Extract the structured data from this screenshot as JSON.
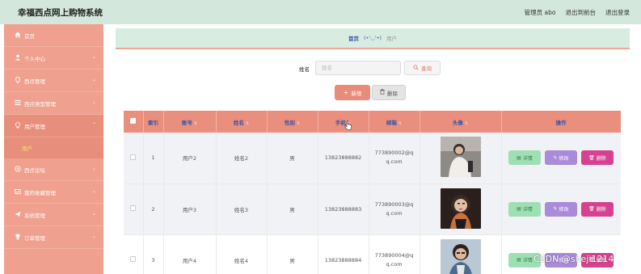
{
  "header": {
    "title": "幸福西点网上购物系统",
    "admin": "管理员 abo",
    "back_to_front": "退出到前台",
    "logout": "退出登录"
  },
  "sidebar": {
    "items": [
      {
        "label": "首页",
        "icon": "home-icon",
        "expandable": false
      },
      {
        "label": "个人中心",
        "icon": "person-icon",
        "expandable": true
      },
      {
        "label": "西点管理",
        "icon": "pin-icon",
        "expandable": true
      },
      {
        "label": "西点类型管理",
        "icon": "list-icon",
        "expandable": true
      },
      {
        "label": "用户管理",
        "icon": "bulb-icon",
        "expandable": true,
        "expanded": true
      },
      {
        "label": "西点论坛",
        "icon": "circle-icon",
        "expandable": true
      },
      {
        "label": "我的收藏管理",
        "icon": "box-icon",
        "expandable": true
      },
      {
        "label": "系统管理",
        "icon": "send-icon",
        "expandable": true
      },
      {
        "label": "订单管理",
        "icon": "trophy-icon",
        "expandable": true
      }
    ],
    "sub_item": "用户"
  },
  "breadcrumb": {
    "home": "首页",
    "separator": "(•'◡'•)",
    "current": "用户"
  },
  "search": {
    "label": "姓名",
    "placeholder": "姓名",
    "value": "",
    "button": "查询"
  },
  "actions": {
    "add": "新增",
    "delete": "删除"
  },
  "table": {
    "columns": [
      "索引",
      "账号",
      "姓名",
      "性别",
      "手机",
      "邮箱",
      "头像",
      "操作"
    ],
    "rows": [
      {
        "index": "1",
        "account": "用户2",
        "name": "姓名2",
        "gender": "男",
        "phone": "13823888882",
        "email_1": "773890002@q",
        "email_2": "q.com"
      },
      {
        "index": "2",
        "account": "用户3",
        "name": "姓名3",
        "gender": "男",
        "phone": "13823888883",
        "email_1": "773890003@q",
        "email_2": "q.com"
      },
      {
        "index": "3",
        "account": "用户4",
        "name": "姓名4",
        "gender": "男",
        "phone": "13823888884",
        "email_1": "773890004@q",
        "email_2": "q.com"
      }
    ],
    "row_actions": {
      "detail": "详情",
      "edit": "修改",
      "delete": "删除"
    }
  },
  "watermark": "CSDN @sheji1214",
  "colors": {
    "header_bg": "#d3e7dc",
    "sidebar_bg": "#f0a08e",
    "table_header_bg": "#ea8f7d",
    "detail_btn": "#9ee0b3",
    "edit_btn": "#a98bd9",
    "delete_btn": "#d6428f"
  }
}
